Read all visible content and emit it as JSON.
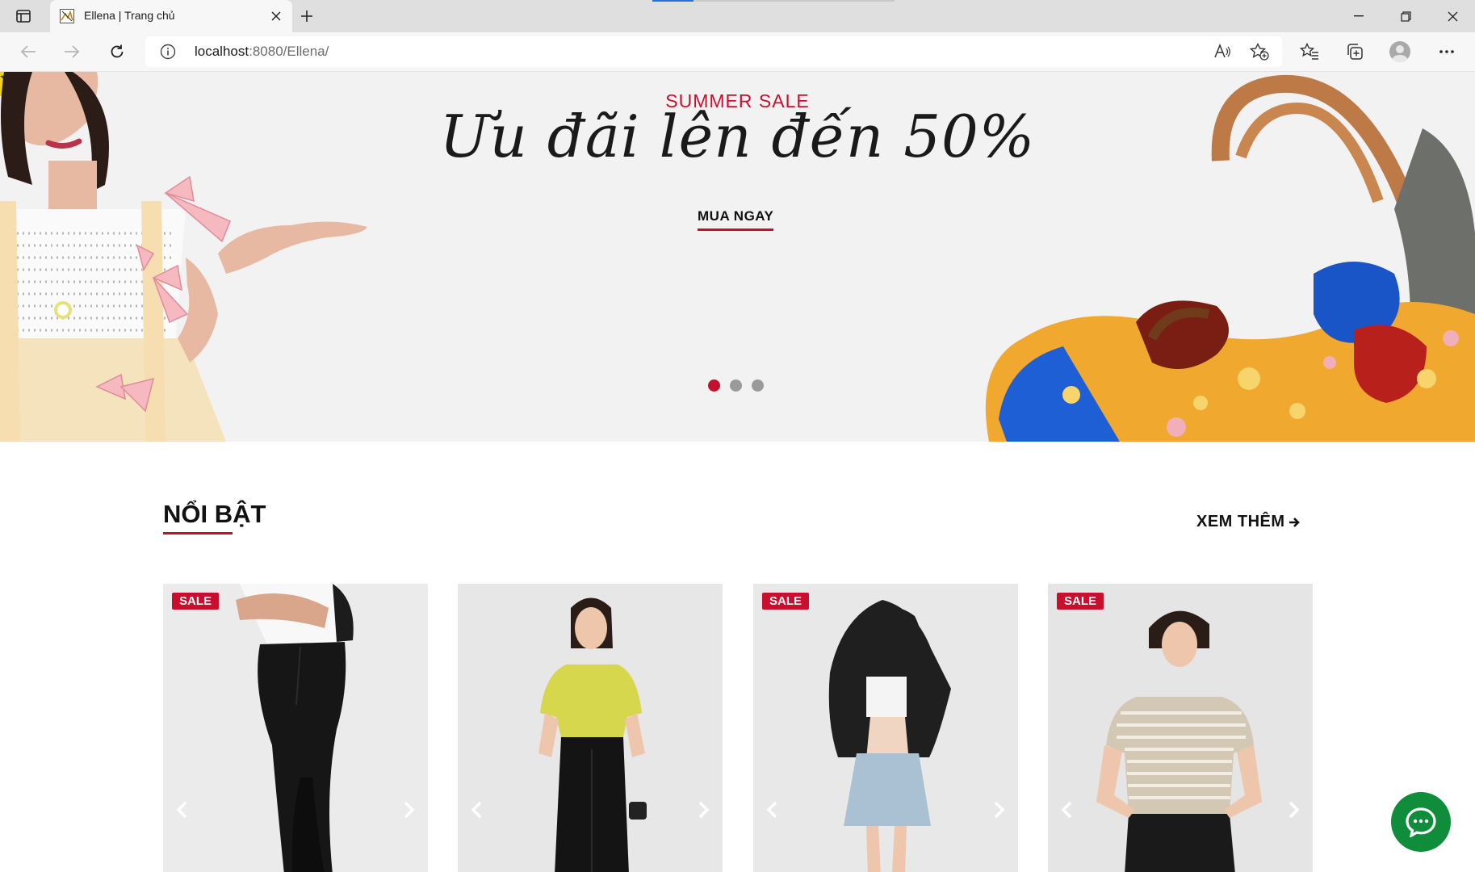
{
  "browser": {
    "tab_title": "Ellena | Trang chủ",
    "url_host": "localhost",
    "url_rest": ":8080/Ellena/",
    "tab_loading_progress": 0.17
  },
  "hero": {
    "subtitle": "SUMMER SALE",
    "title": "Ưu đãi lên đến 50%",
    "cta_label": "MUA NGAY",
    "slide_count": 3,
    "active_slide": 1
  },
  "featured": {
    "title": "NỔI BẬT",
    "see_more_label": "XEM THÊM",
    "products": [
      {
        "badge": "SALE",
        "image": "black-jeans-model"
      },
      {
        "badge": "",
        "image": "yellow-shirt-model"
      },
      {
        "badge": "SALE",
        "image": "black-jacket-model"
      },
      {
        "badge": "SALE",
        "image": "striped-tee-model"
      }
    ]
  },
  "colors": {
    "accent": "#c8102e",
    "chat_button": "#0f8d3b"
  },
  "icons": {
    "chat": "messenger-chat-icon",
    "arrow_right": "arrow-right-icon"
  }
}
